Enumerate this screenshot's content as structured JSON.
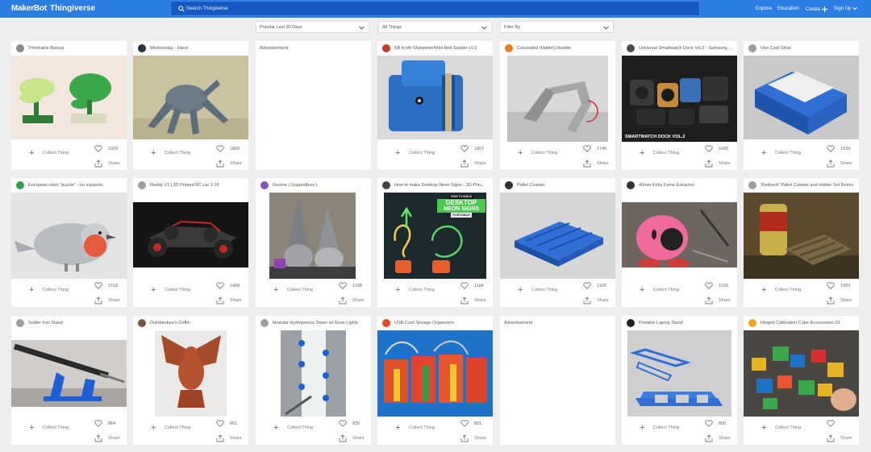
{
  "header": {
    "brand": "MakerBot",
    "product": "Thingiverse",
    "search_placeholder": "Search Thingiverse",
    "nav": {
      "explore": "Explore",
      "education": "Education",
      "create": "Create",
      "signup": "Sign Up"
    }
  },
  "filters": {
    "sort": "Popular Last 30 Days",
    "scope": "All Things",
    "filter_by": "Filter By"
  },
  "card_actions": {
    "collect": "Collect Thing",
    "share": "Share"
  },
  "cards": [
    {
      "title": "Trimmable Bonsai",
      "likes": "2329"
    },
    {
      "title": "Wednesday - Hand",
      "likes": "1809"
    },
    {
      "title": "Advertisement"
    },
    {
      "title": "KB Knife Sharpener/Mini Belt Sander v1.0",
      "likes": "1807"
    },
    {
      "title": "Concealed (hidden) Handle",
      "likes": "1745"
    },
    {
      "title": "Universal Smartwatch Dock Vol.2 - Samsung, ...",
      "likes": "1605",
      "overlay": "SMARTWATCH DOCK VOL.2"
    },
    {
      "title": "Uno Card Shoe",
      "likes": "1520"
    },
    {
      "title": "European robin \"puzzle\" - no supports",
      "likes": "1518"
    },
    {
      "title": "Reddy V1 | 3D Printed RC car 1:10",
      "likes": "1468"
    },
    {
      "title": "Gnome ( Supportless )",
      "likes": "1198"
    },
    {
      "title": "How to make Desktop Neon Signs - 3D Prin...",
      "likes": "1184",
      "overlay": [
        "HOW TO BUILD",
        "DESKTOP",
        "NEON SIGNS",
        "PORTABLE"
      ]
    },
    {
      "title": "Pallet Coaster",
      "likes": "1125"
    },
    {
      "title": "40mm Kirby Fume Extractor",
      "likes": "1103"
    },
    {
      "title": "'Redneck' Pallet Coaster and Holder Set Remix",
      "likes": "1003"
    },
    {
      "title": "Solder Iron Stand",
      "likes": "864"
    },
    {
      "title": "Dumbledore's Griffin",
      "likes": "861"
    },
    {
      "title": "Modular Hydroponics Tower w/ Grow Lights",
      "likes": "835"
    },
    {
      "title": "USB Cord Storage Organizers",
      "likes": "801"
    },
    {
      "title": "Advertisement"
    },
    {
      "title": "Portable Laptop Stand",
      "likes": "800"
    },
    {
      "title": "Hinged Calibration Cube Accessories 03",
      "likes": ""
    }
  ],
  "colors": {
    "brand_blue": "#2a7de1",
    "search_bg": "#1759c2"
  }
}
